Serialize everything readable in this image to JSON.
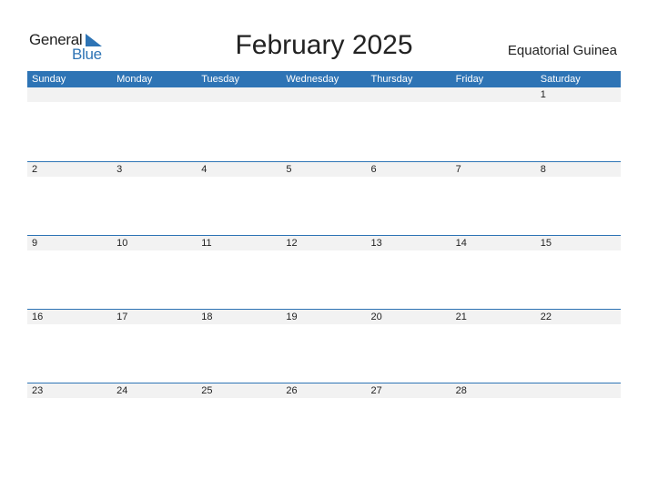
{
  "logo": {
    "line1": "General",
    "line2": "Blue"
  },
  "header": {
    "title": "February 2025",
    "country": "Equatorial Guinea"
  },
  "colors": {
    "accent": "#2E74B5",
    "day_strip": "#f2f2f2"
  },
  "weekdays": [
    "Sunday",
    "Monday",
    "Tuesday",
    "Wednesday",
    "Thursday",
    "Friday",
    "Saturday"
  ],
  "weeks": [
    [
      "",
      "",
      "",
      "",
      "",
      "",
      "1"
    ],
    [
      "2",
      "3",
      "4",
      "5",
      "6",
      "7",
      "8"
    ],
    [
      "9",
      "10",
      "11",
      "12",
      "13",
      "14",
      "15"
    ],
    [
      "16",
      "17",
      "18",
      "19",
      "20",
      "21",
      "22"
    ],
    [
      "23",
      "24",
      "25",
      "26",
      "27",
      "28",
      ""
    ]
  ]
}
